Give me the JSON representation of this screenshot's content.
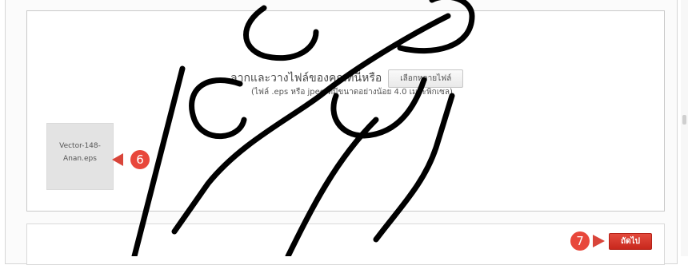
{
  "dropzone": {
    "label": "ลากและวางไฟล์ของคุณที่นี่หรือ",
    "choose_button": "เลือกหลายไฟล์",
    "hint": "(ไฟล์ .eps หรือ jpeg ที่มีขนาดอย่างน้อย 4.0 เมกะพิกเซล)"
  },
  "file": {
    "name_line1": "Vector-148-",
    "name_line2": "Anan.eps"
  },
  "annotations": {
    "step6": "6",
    "step7": "7",
    "color": "#e8473b"
  },
  "footer": {
    "next_button": "ถัดไป"
  }
}
